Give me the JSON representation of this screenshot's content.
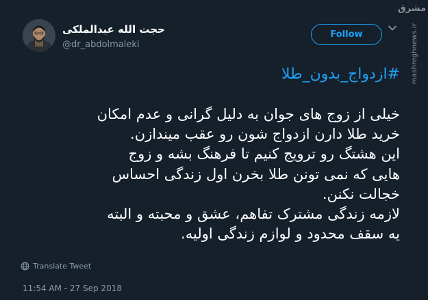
{
  "author": {
    "name": "حجت الله عبدالملکی",
    "handle": "@dr_abdolmaleki"
  },
  "follow_label": "Follow",
  "watermark": {
    "logo": "مشرق",
    "url": "mashreghnews.ir"
  },
  "tweet": {
    "hashtag": "#ازدواج_بدون_طلا",
    "lines": [
      "خیلی از زوج های جوان به دلیل گرانی و عدم امکان",
      "خرید طلا دارن ازدواج شون رو عقب میندازن.",
      "این هشتگ رو ترویج کنیم تا فرهنگ بشه و زوج",
      "هایی که نمی تونن طلا بخرن اول زندگی احساس",
      "خجالت نکنن.",
      "لازمه زندگی مشترک تفاهم، عشق و محبته و البته",
      "یه سقف محدود و لوازم زندگی اولیه."
    ]
  },
  "translate_label": "Translate Tweet",
  "timestamp": "11:54 AM - 27 Sep 2018",
  "icons": {
    "avatar": "avatar-photo",
    "chevron": "chevron-down-icon",
    "translate": "globe-icon"
  },
  "colors": {
    "background": "#15202b",
    "accent": "#1da1f2",
    "secondary_text": "#8899a6"
  }
}
